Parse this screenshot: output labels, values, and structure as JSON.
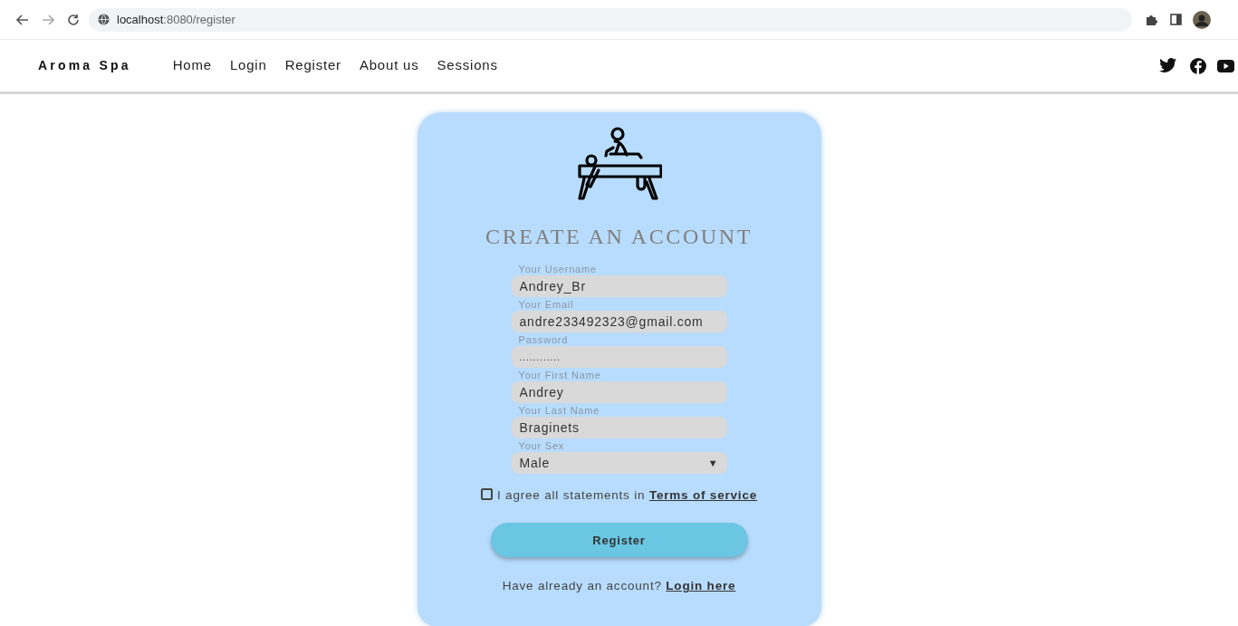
{
  "browser": {
    "url_host": "localhost",
    "url_path": ":8080/register"
  },
  "navbar": {
    "brand": "Aroma Spa",
    "links": [
      {
        "label": "Home"
      },
      {
        "label": "Login"
      },
      {
        "label": "Register"
      },
      {
        "label": "About us"
      },
      {
        "label": "Sessions"
      }
    ]
  },
  "form": {
    "title": "CREATE AN ACCOUNT",
    "fields": [
      {
        "kind": "text",
        "label": "Your Username",
        "value": "Andrey_Br"
      },
      {
        "kind": "text",
        "label": "Your Email",
        "value": "andre233492323@gmail.com"
      },
      {
        "kind": "password",
        "label": "Password",
        "value": "............"
      },
      {
        "kind": "text",
        "label": "Your First Name",
        "value": "Andrey"
      },
      {
        "kind": "text",
        "label": "Your Last Name",
        "value": "Braginets"
      },
      {
        "kind": "select",
        "label": "Your Sex",
        "value": "Male",
        "caret": "▼"
      }
    ],
    "agree": {
      "checked": false,
      "text": "I agree all statements in",
      "link": "Terms of service"
    },
    "submit": "Register",
    "login": {
      "text": "Have already an account?",
      "link": "Login here"
    }
  }
}
